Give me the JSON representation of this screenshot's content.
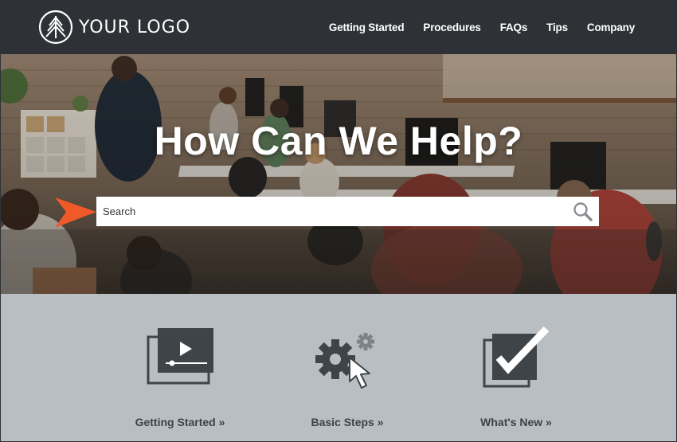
{
  "brand": {
    "logo_text": "YOUR LOGO"
  },
  "nav": {
    "items": [
      {
        "label": "Getting Started"
      },
      {
        "label": "Procedures"
      },
      {
        "label": "FAQs"
      },
      {
        "label": "Tips"
      },
      {
        "label": "Company"
      }
    ]
  },
  "hero": {
    "title": "How Can We Help?",
    "search": {
      "placeholder": "Search",
      "value": ""
    }
  },
  "features": [
    {
      "label": "Getting Started »",
      "icon": "video-player-icon"
    },
    {
      "label": "Basic Steps »",
      "icon": "gears-cursor-icon"
    },
    {
      "label": "What's New »",
      "icon": "checkmark-window-icon"
    }
  ],
  "colors": {
    "header_bg": "#2e3236",
    "features_bg": "#b9bec2",
    "accent_arrow": "#f05a28",
    "icon_dark": "#3f4448"
  }
}
